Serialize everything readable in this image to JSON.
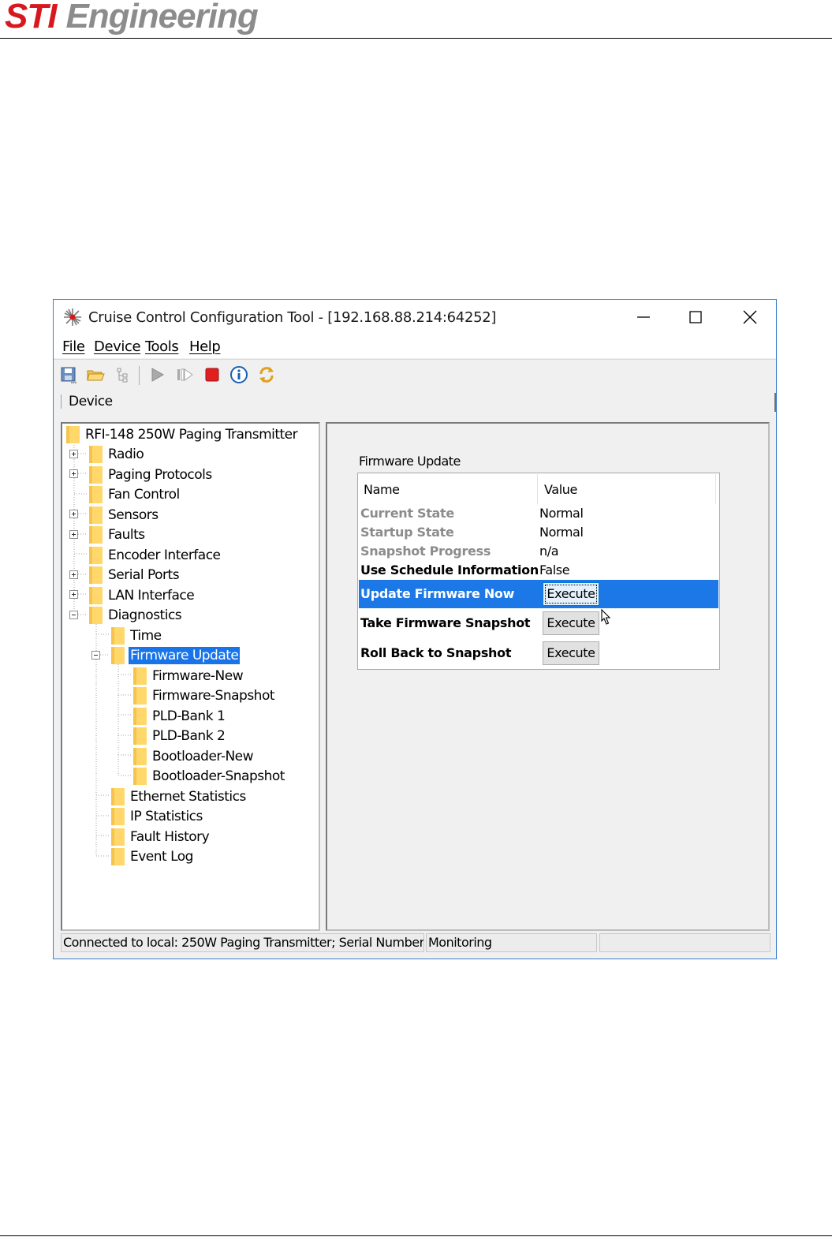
{
  "header": {
    "brand_red": "STI",
    "brand_gray": "Engineering",
    "colors": {
      "red": "#d7191f",
      "gray": "#8c8c8c"
    }
  },
  "window": {
    "title": "Cruise Control Configuration Tool - [192.168.88.214:64252]",
    "icon": "app-starburst-icon"
  },
  "menu": [
    "File",
    "Device",
    "Tools",
    "Help"
  ],
  "toolbar": {
    "icons": [
      "save-icon",
      "open-folder-icon",
      "tree-view-icon",
      "play-icon",
      "step-icon",
      "stop-icon",
      "info-icon",
      "refresh-icon"
    ]
  },
  "device_bar": {
    "label": "Device"
  },
  "tree": {
    "root": "RFI-148 250W Paging Transmitter",
    "items": [
      "Radio",
      "Paging Protocols",
      "Fan Control",
      "Sensors",
      "Faults",
      "Encoder Interface",
      "Serial Ports",
      "LAN Interface",
      "Diagnostics",
      "Time",
      "Firmware Update",
      "Firmware-New",
      "Firmware-Snapshot",
      "PLD-Bank 1",
      "PLD-Bank 2",
      "Bootloader-New",
      "Bootloader-Snapshot",
      "Ethernet Statistics",
      "IP Statistics",
      "Fault History",
      "Event Log"
    ],
    "selected": "Firmware Update"
  },
  "panel": {
    "title": "Firmware Update",
    "columns": [
      "Name",
      "Value"
    ],
    "rows": [
      {
        "name": "Current State",
        "value": "Normal"
      },
      {
        "name": "Startup State",
        "value": "Normal"
      },
      {
        "name": "Snapshot Progress",
        "value": "n/a"
      },
      {
        "name": "Use Schedule Information",
        "value": "False"
      },
      {
        "name": "Update Firmware Now",
        "value": "Execute"
      },
      {
        "name": "Take Firmware Snapshot",
        "value": "Execute"
      },
      {
        "name": "Roll Back to Snapshot",
        "value": "Execute"
      }
    ]
  },
  "status": {
    "connection": "Connected to local: 250W Paging Transmitter; Serial Number …",
    "mode": "Monitoring",
    "extra": ""
  },
  "colors": {
    "selection": "#1874e8",
    "folder": "#ffd76b",
    "window_border": "#3c82c8"
  }
}
